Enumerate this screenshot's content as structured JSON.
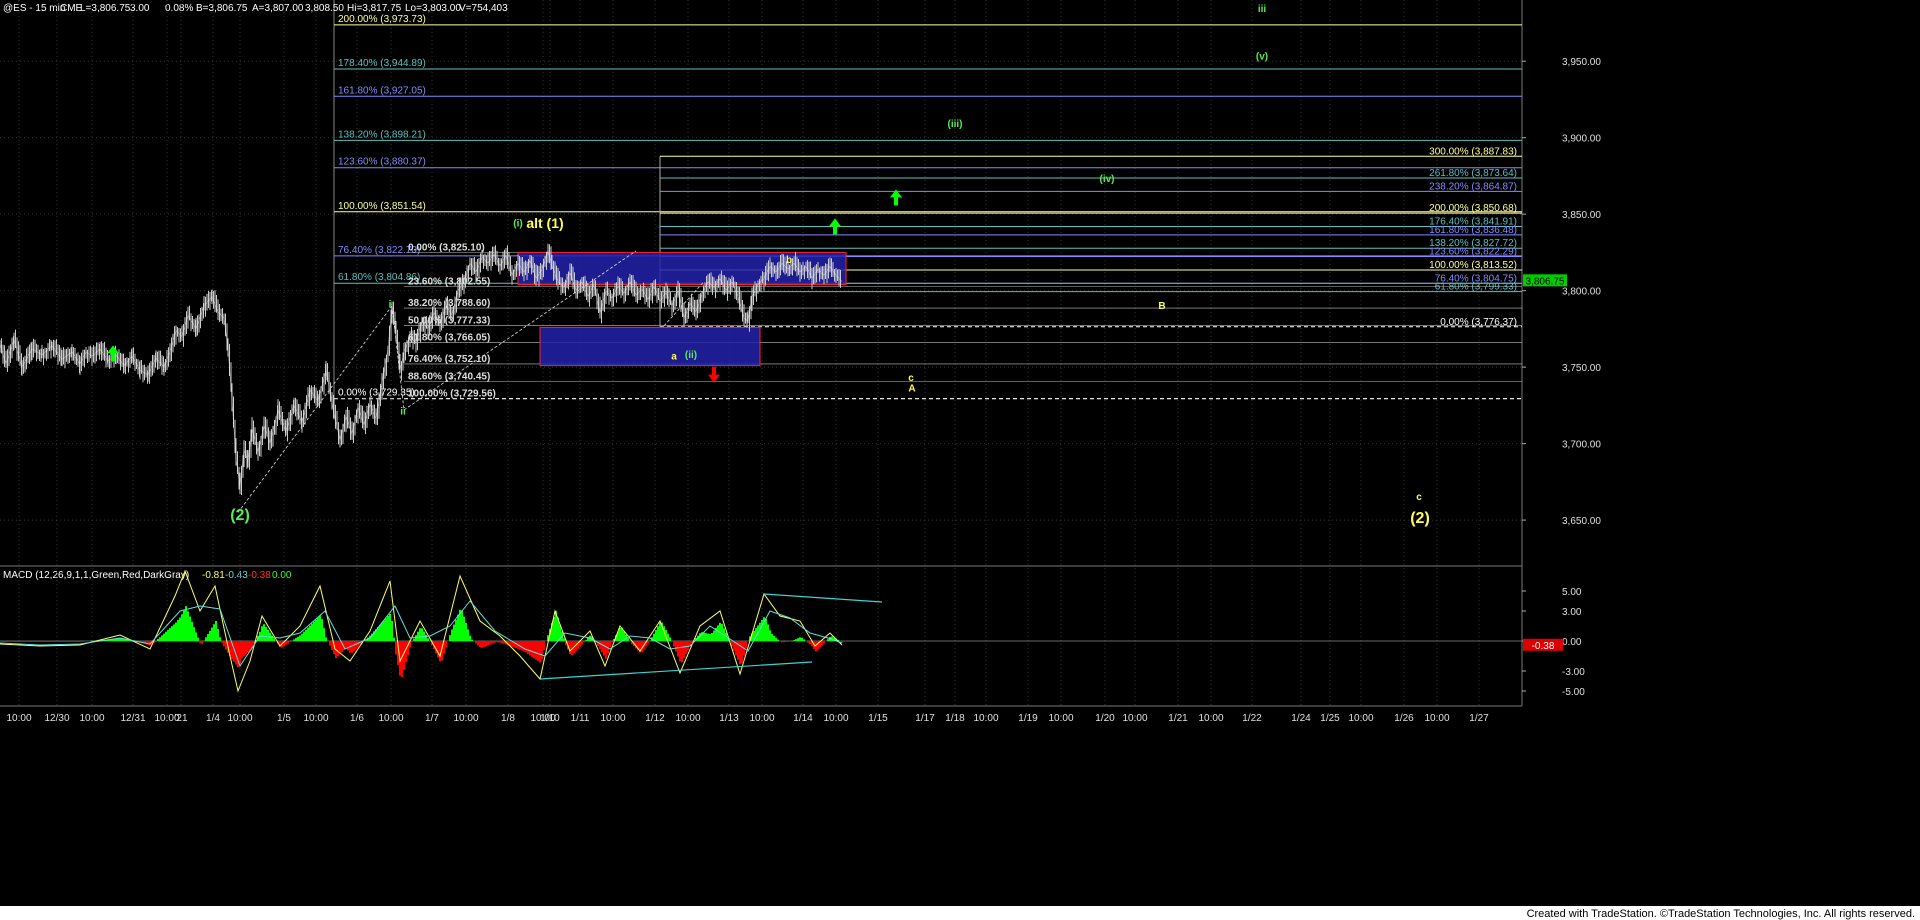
{
  "header": {
    "symbol": "@ES - 15 min",
    "exchange": "CME",
    "last": "L=3,806.75",
    "change": "3.00",
    "pct": "0.08%",
    "bid": "B=3,806.75",
    "ask": "A=3,807.00",
    "open": "3,808.50",
    "high": "Hi=3,817.75",
    "low": "Lo=3,803.00",
    "volume": "V=754,403"
  },
  "macd_header": {
    "label": "MACD (12,26,9,1,1,Green,Red,DarkGray)",
    "v1": "-0.81",
    "v2": "-0.43",
    "v3": "-0.38",
    "v4": "0.00"
  },
  "footer": {
    "credit": "Created with TradeStation. ©TradeStation Technologies, Inc. All rights reserved."
  },
  "colors": {
    "background": "#000000",
    "bull": "#00ff00",
    "bear": "#ff0000",
    "price_bar": "#cccccc",
    "fib_yellow": "#ffff99",
    "fib_blue": "#8888ff",
    "fib_cyan": "#5fbfbf",
    "box": "#2222aa",
    "box_border": "#ff2222",
    "wave_green": "#55ee55",
    "wave_yellow": "#ffff55",
    "macd_fast": "#ffff66",
    "macd_slow": "#66dddd",
    "trendline": "#40d0d0"
  },
  "chart_data": [
    {
      "type": "candlestick",
      "name": "@ES - 15 min",
      "ylim": [
        3620,
        3990
      ],
      "y_ticks": [
        "3,950.00",
        "3,900.00",
        "3,850.00",
        "3,800.00",
        "3,750.00",
        "3,700.00",
        "3,650.00"
      ],
      "y_tick_values": [
        3950,
        3900,
        3850,
        3800,
        3750,
        3700,
        3650
      ],
      "last_price_tag": "3,806.75",
      "last_price_value": 3806.75,
      "x_ticks": [
        "10:00",
        "12/30",
        "10:00",
        "12/31",
        "10:00",
        "'21",
        "1/4",
        "10:00",
        "1/5",
        "10:00",
        "1/6",
        "10:00",
        "1/7",
        "10:00",
        "1/8",
        "10:00",
        "1/10",
        "1/11",
        "10:00",
        "1/12",
        "10:00",
        "1/13",
        "10:00",
        "1/14",
        "10:00",
        "1/15",
        "1/17",
        "1/18",
        "10:00",
        "1/19",
        "10:00",
        "1/20",
        "10:00",
        "1/21",
        "10:00",
        "1/22",
        "1/24",
        "1/25",
        "10:00",
        "1/26",
        "10:00",
        "1/27"
      ],
      "price_path": [
        [
          0,
          3765
        ],
        [
          6,
          3752
        ],
        [
          14,
          3768
        ],
        [
          22,
          3750
        ],
        [
          32,
          3762
        ],
        [
          42,
          3758
        ],
        [
          52,
          3764
        ],
        [
          62,
          3755
        ],
        [
          72,
          3760
        ],
        [
          80,
          3752
        ],
        [
          86,
          3760
        ],
        [
          92,
          3757
        ],
        [
          100,
          3762
        ],
        [
          108,
          3754
        ],
        [
          116,
          3758
        ],
        [
          124,
          3751
        ],
        [
          132,
          3757
        ],
        [
          140,
          3748
        ],
        [
          148,
          3745
        ],
        [
          156,
          3756
        ],
        [
          164,
          3750
        ],
        [
          170,
          3760
        ],
        [
          176,
          3774
        ],
        [
          182,
          3770
        ],
        [
          188,
          3784
        ],
        [
          196,
          3775
        ],
        [
          204,
          3790
        ],
        [
          212,
          3796
        ],
        [
          218,
          3786
        ],
        [
          224,
          3782
        ],
        [
          228,
          3762
        ],
        [
          232,
          3728
        ],
        [
          236,
          3690
        ],
        [
          240,
          3672
        ],
        [
          244,
          3696
        ],
        [
          248,
          3688
        ],
        [
          252,
          3710
        ],
        [
          258,
          3694
        ],
        [
          264,
          3712
        ],
        [
          270,
          3700
        ],
        [
          278,
          3722
        ],
        [
          286,
          3708
        ],
        [
          294,
          3725
        ],
        [
          302,
          3714
        ],
        [
          310,
          3735
        ],
        [
          318,
          3728
        ],
        [
          326,
          3748
        ],
        [
          334,
          3720
        ],
        [
          340,
          3702
        ],
        [
          346,
          3718
        ],
        [
          352,
          3706
        ],
        [
          358,
          3724
        ],
        [
          364,
          3712
        ],
        [
          370,
          3726
        ],
        [
          376,
          3716
        ],
        [
          382,
          3740
        ],
        [
          388,
          3762
        ],
        [
          392,
          3790
        ],
        [
          396,
          3772
        ],
        [
          400,
          3748
        ],
        [
          404,
          3760
        ],
        [
          410,
          3770
        ],
        [
          416,
          3766
        ],
        [
          422,
          3780
        ],
        [
          428,
          3775
        ],
        [
          434,
          3786
        ],
        [
          440,
          3778
        ],
        [
          446,
          3790
        ],
        [
          452,
          3784
        ],
        [
          458,
          3800
        ],
        [
          464,
          3806
        ],
        [
          470,
          3818
        ],
        [
          476,
          3812
        ],
        [
          482,
          3822
        ],
        [
          488,
          3818
        ],
        [
          494,
          3824
        ],
        [
          500,
          3816
        ],
        [
          506,
          3823
        ],
        [
          512,
          3810
        ],
        [
          518,
          3818
        ],
        [
          524,
          3812
        ],
        [
          530,
          3820
        ],
        [
          536,
          3808
        ],
        [
          542,
          3814
        ],
        [
          548,
          3826
        ],
        [
          552,
          3816
        ],
        [
          558,
          3806
        ],
        [
          564,
          3802
        ],
        [
          570,
          3812
        ],
        [
          576,
          3800
        ],
        [
          582,
          3806
        ],
        [
          588,
          3796
        ],
        [
          594,
          3804
        ],
        [
          600,
          3785
        ],
        [
          606,
          3800
        ],
        [
          612,
          3795
        ],
        [
          618,
          3803
        ],
        [
          624,
          3798
        ],
        [
          630,
          3806
        ],
        [
          636,
          3797
        ],
        [
          642,
          3801
        ],
        [
          648,
          3794
        ],
        [
          654,
          3803
        ],
        [
          660,
          3793
        ],
        [
          666,
          3799
        ],
        [
          672,
          3790
        ],
        [
          678,
          3800
        ],
        [
          684,
          3782
        ],
        [
          690,
          3792
        ],
        [
          696,
          3786
        ],
        [
          702,
          3798
        ],
        [
          708,
          3806
        ],
        [
          714,
          3802
        ],
        [
          720,
          3808
        ],
        [
          726,
          3800
        ],
        [
          732,
          3806
        ],
        [
          738,
          3796
        ],
        [
          744,
          3782
        ],
        [
          748,
          3780
        ],
        [
          752,
          3796
        ],
        [
          758,
          3804
        ],
        [
          764,
          3808
        ],
        [
          770,
          3816
        ],
        [
          776,
          3812
        ],
        [
          782,
          3818
        ],
        [
          788,
          3814
        ],
        [
          794,
          3818
        ],
        [
          800,
          3812
        ],
        [
          806,
          3816
        ],
        [
          812,
          3808
        ],
        [
          818,
          3814
        ],
        [
          824,
          3810
        ],
        [
          830,
          3816
        ],
        [
          836,
          3810
        ],
        [
          842,
          3806
        ]
      ],
      "fib_levels_left": [
        {
          "label": "200.00% (3,973.73)",
          "value": 3973.73,
          "color": "#ffff99"
        },
        {
          "label": "178.40% (3,944.89)",
          "value": 3944.89,
          "color": "#5fbfbf"
        },
        {
          "label": "161.80% (3,927.05)",
          "value": 3927.05,
          "color": "#8888ff"
        },
        {
          "label": "138.20% (3,898.21)",
          "value": 3898.21,
          "color": "#5fbfbf"
        },
        {
          "label": "123.60% (3,880.37)",
          "value": 3880.37,
          "color": "#8888ff"
        },
        {
          "label": "100.00% (3,851.54)",
          "value": 3851.54,
          "color": "#ffff99"
        },
        {
          "label": "76.40% (3,822.70)",
          "value": 3822.7,
          "color": "#8888ff"
        },
        {
          "label": "61.80% (3,804.86)",
          "value": 3804.86,
          "color": "#5fbfbf"
        },
        {
          "label": "0.00% (3,729.35)",
          "value": 3729.35,
          "color": "#ffffff"
        }
      ],
      "fib_retrace": [
        {
          "label": "0.00% (3,825.10)",
          "value": 3825.1
        },
        {
          "label": "23.60% (3,802.55)",
          "value": 3802.55
        },
        {
          "label": "38.20% (3,788.60)",
          "value": 3788.6
        },
        {
          "label": "50.00% (3,777.33)",
          "value": 3777.33
        },
        {
          "label": "61.80% (3,766.05)",
          "value": 3766.05
        },
        {
          "label": "76.40% (3,752.10)",
          "value": 3752.1
        },
        {
          "label": "88.60% (3,740.45)",
          "value": 3740.45
        },
        {
          "label": "100.00% (3,729.56)",
          "value": 3729.56
        }
      ],
      "fib_levels_right": [
        {
          "label": "300.00% (3,887.83)",
          "value": 3887.83,
          "color": "#ffff99"
        },
        {
          "label": "261.80% (3,873.64)",
          "value": 3873.64,
          "color": "#5fbfbf"
        },
        {
          "label": "238.20% (3,864.87)",
          "value": 3864.87,
          "color": "#8888ff"
        },
        {
          "label": "200.00% (3,850.68)",
          "value": 3850.68,
          "color": "#ffff99"
        },
        {
          "label": "176.40% (3,841.91)",
          "value": 3841.91,
          "color": "#5fbfbf"
        },
        {
          "label": "161.80% (3,836.48)",
          "value": 3836.48,
          "color": "#8888ff"
        },
        {
          "label": "138.20% (3,827.72)",
          "value": 3827.72,
          "color": "#5fbfbf"
        },
        {
          "label": "123.60% (3,822.29)",
          "value": 3822.29,
          "color": "#8888ff"
        },
        {
          "label": "100.00% (3,813.52)",
          "value": 3813.52,
          "color": "#ffff99"
        },
        {
          "label": "76.40% (3,804.75)",
          "value": 3804.75,
          "color": "#8888ff"
        },
        {
          "label": "61.80% (3,799.33)",
          "value": 3799.33,
          "color": "#5fbfbf"
        },
        {
          "label": "0.00% (3,776.37)",
          "value": 3776.37,
          "color": "#ffffff"
        }
      ],
      "wave_labels": [
        {
          "text": "(2)",
          "color": "#55ee55",
          "x": 240,
          "y": 3650
        },
        {
          "text": "i",
          "color": "#55ee55",
          "x": 390,
          "y": 3789
        },
        {
          "text": "ii",
          "color": "#55ee55",
          "x": 403,
          "y": 3719
        },
        {
          "text": "(i)",
          "color": "#55ee55",
          "x": 518,
          "y": 3842
        },
        {
          "text": "alt (1)",
          "color": "#ffff55",
          "x": 545,
          "y": 3841
        },
        {
          "text": "a",
          "color": "#ffff55",
          "x": 674,
          "y": 3755
        },
        {
          "text": "(ii)",
          "color": "#55ee55",
          "x": 691,
          "y": 3756
        },
        {
          "text": "b",
          "color": "#ffff55",
          "x": 789,
          "y": 3818
        },
        {
          "text": "(iii)",
          "color": "#55ee55",
          "x": 955,
          "y": 3907
        },
        {
          "text": "(iv)",
          "color": "#55ee55",
          "x": 1107,
          "y": 3871
        },
        {
          "text": "iii",
          "color": "#55ee55",
          "x": 1262,
          "y": 3982
        },
        {
          "text": "(v)",
          "color": "#55ee55",
          "x": 1262,
          "y": 3951
        },
        {
          "text": "B",
          "color": "#ffff55",
          "x": 1162,
          "y": 3788
        },
        {
          "text": "c",
          "color": "#ffff55",
          "x": 911,
          "y": 3741
        },
        {
          "text": "A",
          "color": "#ffff55",
          "x": 912,
          "y": 3734
        },
        {
          "text": "c",
          "color": "#ffff55",
          "x": 1419,
          "y": 3663
        },
        {
          "text": "(2)",
          "color": "#ffff55",
          "x": 1420,
          "y": 3648
        }
      ]
    },
    {
      "type": "line",
      "name": "MACD (12,26,9,1,1,Green,Red,DarkGray)",
      "ylim": [
        -6.5,
        7.5
      ],
      "y_ticks": [
        "5.00",
        "3.00",
        "0.00",
        "-3.00",
        "-5.00"
      ],
      "y_tick_values": [
        5,
        3,
        0,
        -3,
        -5
      ],
      "last_value_tag": "-0.38",
      "last_value": -0.38,
      "macd_fast": [
        [
          0,
          -0.3
        ],
        [
          40,
          -0.5
        ],
        [
          80,
          -0.4
        ],
        [
          120,
          0.6
        ],
        [
          150,
          -0.8
        ],
        [
          175,
          4.5
        ],
        [
          185,
          7.0
        ],
        [
          200,
          3.0
        ],
        [
          215,
          5.5
        ],
        [
          230,
          -1.5
        ],
        [
          238,
          -5.0
        ],
        [
          250,
          -2.0
        ],
        [
          262,
          2.5
        ],
        [
          280,
          -0.5
        ],
        [
          300,
          1.5
        ],
        [
          320,
          5.5
        ],
        [
          335,
          -0.8
        ],
        [
          350,
          -2.0
        ],
        [
          370,
          1.0
        ],
        [
          390,
          6.0
        ],
        [
          400,
          -2.0
        ],
        [
          420,
          2.0
        ],
        [
          440,
          -1.5
        ],
        [
          460,
          6.5
        ],
        [
          480,
          2.0
        ],
        [
          500,
          0.5
        ],
        [
          520,
          -1.5
        ],
        [
          540,
          -3.8
        ],
        [
          555,
          3.0
        ],
        [
          570,
          -1.0
        ],
        [
          590,
          1.0
        ],
        [
          605,
          -2.5
        ],
        [
          620,
          1.5
        ],
        [
          640,
          -1.0
        ],
        [
          660,
          2.0
        ],
        [
          680,
          -3.2
        ],
        [
          700,
          1.5
        ],
        [
          720,
          3.0
        ],
        [
          740,
          -3.3
        ],
        [
          764,
          4.7
        ],
        [
          780,
          2.5
        ],
        [
          800,
          2.0
        ],
        [
          815,
          -0.5
        ],
        [
          830,
          0.8
        ],
        [
          842,
          -0.4
        ]
      ],
      "macd_slow": [
        [
          0,
          -0.2
        ],
        [
          40,
          -0.4
        ],
        [
          80,
          -0.3
        ],
        [
          120,
          0.3
        ],
        [
          150,
          -0.3
        ],
        [
          180,
          3.0
        ],
        [
          200,
          3.5
        ],
        [
          220,
          3.2
        ],
        [
          240,
          -2.5
        ],
        [
          260,
          0.5
        ],
        [
          280,
          0.3
        ],
        [
          300,
          0.8
        ],
        [
          325,
          3.0
        ],
        [
          345,
          -0.8
        ],
        [
          370,
          0.3
        ],
        [
          395,
          3.5
        ],
        [
          410,
          0.3
        ],
        [
          430,
          0.5
        ],
        [
          450,
          1.5
        ],
        [
          470,
          4.0
        ],
        [
          495,
          1.0
        ],
        [
          525,
          -0.8
        ],
        [
          545,
          -1.5
        ],
        [
          565,
          0.8
        ],
        [
          590,
          0.3
        ],
        [
          610,
          -0.8
        ],
        [
          630,
          0.5
        ],
        [
          650,
          0.3
        ],
        [
          670,
          -0.8
        ],
        [
          690,
          -0.5
        ],
        [
          710,
          1.5
        ],
        [
          730,
          0.2
        ],
        [
          748,
          -1.0
        ],
        [
          770,
          3.0
        ],
        [
          790,
          2.3
        ],
        [
          810,
          0.8
        ],
        [
          828,
          0.3
        ],
        [
          842,
          -0.2
        ]
      ],
      "trendlines": [
        {
          "from": [
            764,
            4.7
          ],
          "to": [
            882,
            3.9
          ]
        },
        {
          "from": [
            540,
            -3.8
          ],
          "to": [
            812,
            -2.1
          ]
        }
      ]
    }
  ]
}
